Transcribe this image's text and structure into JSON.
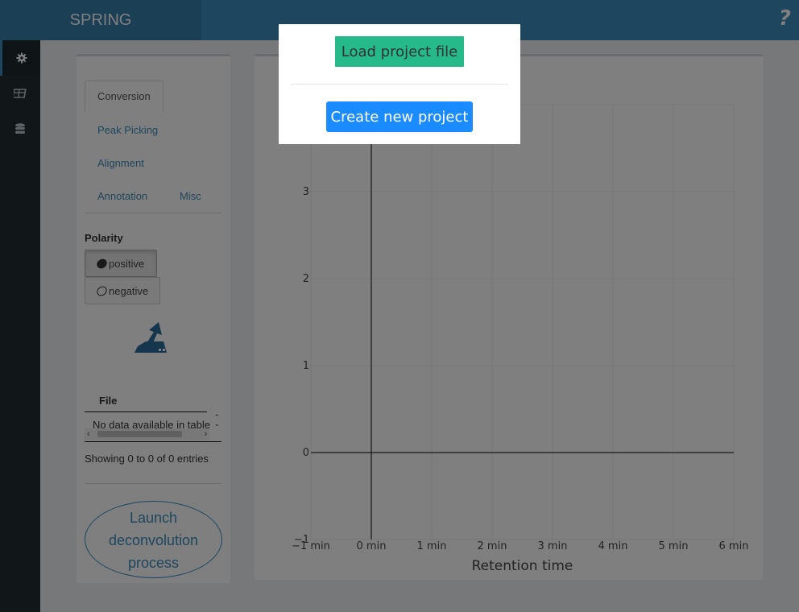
{
  "header": {
    "title": "SPRING",
    "help_icon": "?"
  },
  "sidebar": {
    "icons": [
      "gear-icon",
      "table-icon",
      "database-icon"
    ]
  },
  "tabs": [
    {
      "label": "Conversion",
      "active": true
    },
    {
      "label": "Peak Picking"
    },
    {
      "label": "Alignment"
    },
    {
      "label": "Annotation"
    },
    {
      "label": "Misc"
    }
  ],
  "polarity": {
    "label": "Polarity",
    "options": [
      {
        "label": "positive",
        "selected": true
      },
      {
        "label": "negative",
        "selected": false
      }
    ]
  },
  "files_table": {
    "column": "File",
    "empty_text": "No data available in table",
    "info": "Showing 0 to 0 of 0 entries"
  },
  "launch_button": {
    "line1": "Launch",
    "line2": "deconvolution",
    "line3": "process"
  },
  "modal": {
    "load_label": "Load project file",
    "create_label": "Create new project",
    "load_color": "#26b98a",
    "create_color": "#1a8cff"
  },
  "chart_data": {
    "type": "line",
    "title": "",
    "xlabel": "Retention time",
    "ylabel": "",
    "x_ticks": [
      "−1 min",
      "0 min",
      "1 min",
      "2 min",
      "3 min",
      "4 min",
      "5 min",
      "6 min"
    ],
    "y_ticks": [
      "−1",
      "0",
      "1",
      "2",
      "3"
    ],
    "xlim": [
      -1,
      6
    ],
    "ylim": [
      -1,
      4
    ],
    "series": []
  }
}
